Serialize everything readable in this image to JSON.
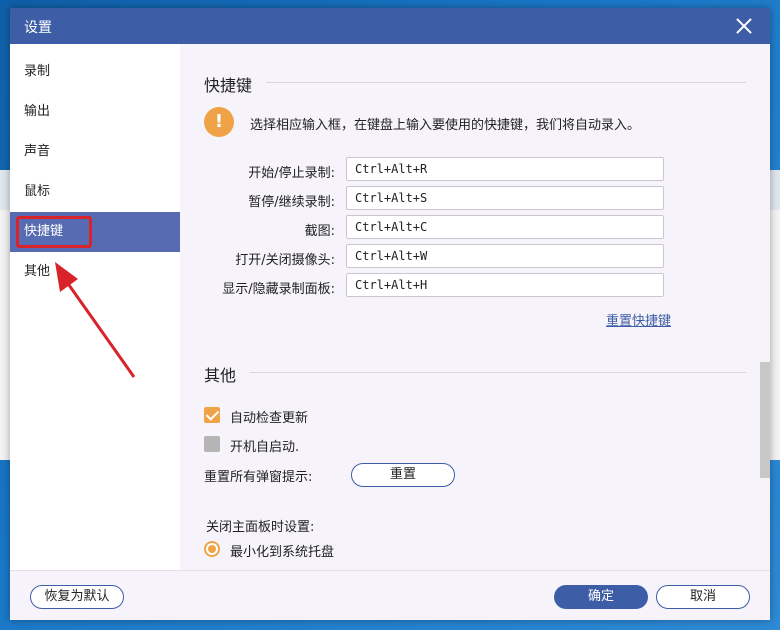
{
  "dialog": {
    "title": "设置"
  },
  "sidebar": {
    "items": [
      {
        "label": "录制"
      },
      {
        "label": "输出"
      },
      {
        "label": "声音"
      },
      {
        "label": "鼠标"
      },
      {
        "label": "快捷键"
      },
      {
        "label": "其他"
      }
    ],
    "active_index": 4
  },
  "shortcuts": {
    "section_title": "快捷键",
    "info": "选择相应输入框，在键盘上输入要使用的快捷键，我们将自动录入。",
    "rows": [
      {
        "label": "开始/停止录制:",
        "value": "Ctrl+Alt+R"
      },
      {
        "label": "暂停/继续录制:",
        "value": "Ctrl+Alt+S"
      },
      {
        "label": "截图:",
        "value": "Ctrl+Alt+C"
      },
      {
        "label": "打开/关闭摄像头:",
        "value": "Ctrl+Alt+W"
      },
      {
        "label": "显示/隐藏录制面板:",
        "value": "Ctrl+Alt+H"
      }
    ],
    "reset_link": "重置快捷键"
  },
  "other": {
    "section_title": "其他",
    "auto_update": {
      "label": "自动检查更新",
      "checked": true
    },
    "autostart": {
      "label": "开机自启动.",
      "checked": false
    },
    "reset_popups_label": "重置所有弹窗提示:",
    "reset_button": "重置",
    "close_panel_label": "关闭主面板时设置:",
    "minimize_option": {
      "label": "最小化到系统托盘",
      "selected": true
    }
  },
  "footer": {
    "restore_defaults": "恢复为默认",
    "ok": "确定",
    "cancel": "取消"
  },
  "colors": {
    "accent": "#3d5da6",
    "sidebar_active": "#566bb1",
    "orange": "#f0a346",
    "annotation_red": "#d8232a"
  }
}
